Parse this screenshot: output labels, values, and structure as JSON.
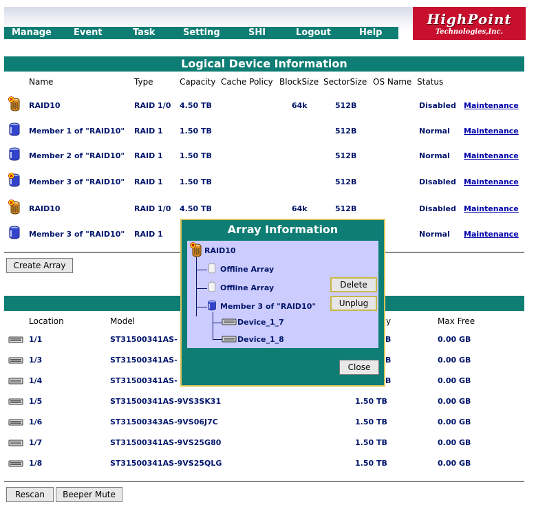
{
  "nav": {
    "items": [
      "Manage",
      "Event",
      "Task",
      "Setting",
      "SHI",
      "Logout",
      "Help"
    ]
  },
  "logo": {
    "line1": "HighPoint",
    "line2": "Technologies,Inc."
  },
  "logical": {
    "title": "Logical Device Information",
    "headers": [
      "Name",
      "Type",
      "Capacity",
      "Cache Policy",
      "BlockSize",
      "SectorSize",
      "OS Name",
      "Status"
    ],
    "rows": [
      {
        "name": "RAID10",
        "type": "RAID 1/0",
        "capacity": "4.50 TB",
        "cache": "",
        "block": "64k",
        "sector": "512B",
        "os": "",
        "status": "Disabled",
        "action": "Maintenance",
        "icon": "raid-disabled-icon"
      },
      {
        "name": "Member 1 of \"RAID10\"",
        "type": "RAID 1",
        "capacity": "1.50 TB",
        "cache": "",
        "block": "",
        "sector": "512B",
        "os": "",
        "status": "Normal",
        "action": "Maintenance",
        "icon": "array-normal-icon"
      },
      {
        "name": "Member 2 of \"RAID10\"",
        "type": "RAID 1",
        "capacity": "1.50 TB",
        "cache": "",
        "block": "",
        "sector": "512B",
        "os": "",
        "status": "Normal",
        "action": "Maintenance",
        "icon": "array-normal-icon"
      },
      {
        "name": "Member 3 of \"RAID10\"",
        "type": "RAID 1",
        "capacity": "1.50 TB",
        "cache": "",
        "block": "",
        "sector": "512B",
        "os": "",
        "status": "Disabled",
        "action": "Maintenance",
        "icon": "array-disabled-icon"
      },
      {
        "name": "RAID10",
        "type": "RAID 1/0",
        "capacity": "4.50 TB",
        "cache": "",
        "block": "64k",
        "sector": "512B",
        "os": "",
        "status": "Disabled",
        "action": "Maintenance",
        "icon": "raid-disabled-icon"
      },
      {
        "name": "Member 3 of \"RAID10\"",
        "type": "RAID 1",
        "capacity": "",
        "cache": "",
        "block": "",
        "sector": "",
        "os": "",
        "status": "Normal",
        "action": "Maintenance",
        "icon": "array-normal-icon"
      }
    ]
  },
  "create_array_label": "Create Array",
  "physical": {
    "headers": {
      "location": "Location",
      "model": "Model",
      "capacity_partial": "y",
      "maxfree": "Max Free"
    },
    "rows": [
      {
        "location": "1/1",
        "model": "ST31500341AS-",
        "capacity": "B",
        "maxfree": "0.00 GB"
      },
      {
        "location": "1/3",
        "model": "ST31500341AS-",
        "capacity": "B",
        "maxfree": "0.00 GB"
      },
      {
        "location": "1/4",
        "model": "ST31500341AS-",
        "capacity": "B",
        "maxfree": "0.00 GB"
      },
      {
        "location": "1/5",
        "model": "ST31500341AS-9VS3SK31",
        "capacity": "1.50 TB",
        "maxfree": "0.00 GB"
      },
      {
        "location": "1/6",
        "model": "ST31500343AS-9VS06J7C",
        "capacity": "1.50 TB",
        "maxfree": "0.00 GB"
      },
      {
        "location": "1/7",
        "model": "ST31500341AS-9VS25G80",
        "capacity": "1.50 TB",
        "maxfree": "0.00 GB"
      },
      {
        "location": "1/8",
        "model": "ST31500341AS-9VS25QLG",
        "capacity": "1.50 TB",
        "maxfree": "0.00 GB"
      }
    ]
  },
  "bottom": {
    "rescan": "Rescan",
    "beeper": "Beeper Mute"
  },
  "popup": {
    "title": "Array Information",
    "root": "RAID10",
    "children": [
      "Offline Array",
      "Offline Array",
      "Member 3 of \"RAID10\""
    ],
    "devices": [
      "Device_1_7",
      "Device_1_8"
    ],
    "delete_label": "Delete",
    "unplug_label": "Unplug",
    "close_label": "Close"
  },
  "colors": {
    "teal": "#0e7d74",
    "navy_text": "#00156b",
    "logo_red": "#c8102e",
    "tree_bg": "#ccccff"
  }
}
